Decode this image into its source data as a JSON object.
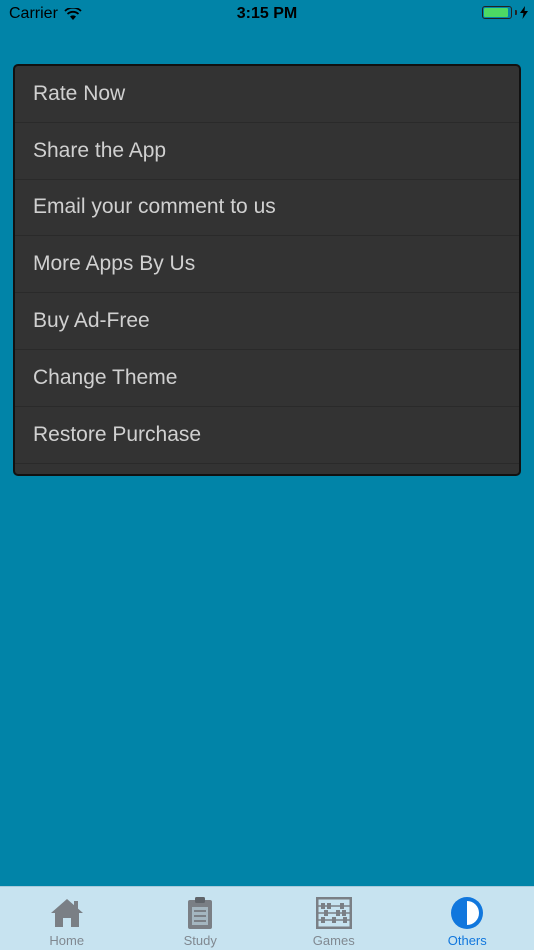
{
  "status_bar": {
    "carrier": "Carrier",
    "time": "3:15 PM",
    "battery_color": "#4cd964"
  },
  "menu": {
    "items": [
      {
        "label": "Rate Now"
      },
      {
        "label": "Share the App"
      },
      {
        "label": "Email your comment to us"
      },
      {
        "label": "More Apps By Us"
      },
      {
        "label": "Buy Ad-Free"
      },
      {
        "label": "Change Theme"
      },
      {
        "label": "Restore Purchase"
      }
    ]
  },
  "tab_bar": {
    "tabs": [
      {
        "label": "Home",
        "icon": "home-icon",
        "active": false
      },
      {
        "label": "Study",
        "icon": "clipboard-icon",
        "active": false
      },
      {
        "label": "Games",
        "icon": "abacus-icon",
        "active": false
      },
      {
        "label": "Others",
        "icon": "pie-icon",
        "active": true
      }
    ],
    "active_color": "#1177dd",
    "inactive_color": "#808890"
  },
  "colors": {
    "background": "#0184a8",
    "menu_background": "#333333"
  }
}
